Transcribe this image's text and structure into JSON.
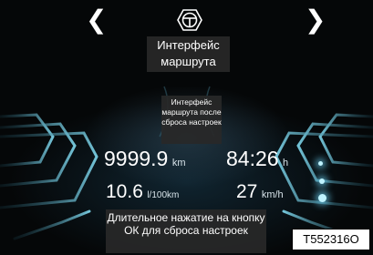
{
  "nav": {
    "prev_icon": "chevron-left",
    "next_icon": "chevron-right",
    "center_icon": "steering-wheel"
  },
  "captions": {
    "top": "Интерфейс маршрута",
    "middle": "Интерфейс маршрута после сброса настроек",
    "bottom": "Длительное нажатие на кнопку ОК для сброса настроек"
  },
  "trip": {
    "distance": {
      "value": "9999.9",
      "unit": "km"
    },
    "time": {
      "value": "84:26",
      "unit": "h"
    },
    "consumption": {
      "value": "10.6",
      "unit": "l/100km"
    },
    "speed": {
      "value": "27",
      "unit": "km/h"
    }
  },
  "figure_code": "T552316O",
  "colors": {
    "accent_cyan": "#9fe6ff",
    "background": "#050708",
    "caption_bg": "#282828"
  }
}
